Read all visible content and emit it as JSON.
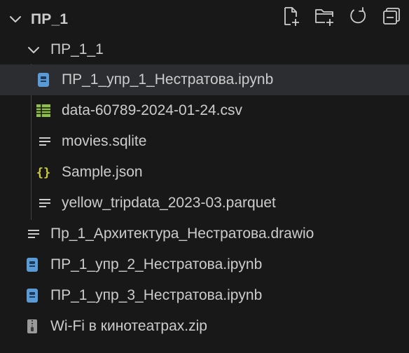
{
  "explorer": {
    "root_folder": "ПР_1",
    "actions": [
      {
        "name": "new-file-icon"
      },
      {
        "name": "new-folder-icon"
      },
      {
        "name": "refresh-icon"
      },
      {
        "name": "collapse-all-icon"
      }
    ],
    "subfolder": "ПР_1_1",
    "items": [
      {
        "label": "ПР_1_упр_1_Нестратова.ipynb",
        "icon": "notebook-icon"
      },
      {
        "label": "data-60789-2024-01-24.csv",
        "icon": "csv-table-icon"
      },
      {
        "label": "movies.sqlite",
        "icon": "text-file-icon"
      },
      {
        "label": "Sample.json",
        "icon": "json-braces-icon"
      },
      {
        "label": "yellow_tripdata_2023-03.parquet",
        "icon": "text-file-icon"
      },
      {
        "label": "Пр_1_Архитектура_Нестратова.drawio",
        "icon": "text-file-icon"
      },
      {
        "label": "ПР_1_упр_2_Нестратова.ipynb",
        "icon": "notebook-icon"
      },
      {
        "label": "ПР_1_упр_3_Нестратова.ipynb",
        "icon": "notebook-icon"
      },
      {
        "label": "Wi-Fi в кинотеатрах.zip",
        "icon": "zip-archive-icon"
      }
    ],
    "colors": {
      "background": "#181818",
      "selected_row": "#2b2d30",
      "text": "#cccccc",
      "notebook_icon": "#5b9bd5",
      "csv_icon": "#8dc149",
      "json_icon": "#cbcb41"
    }
  }
}
